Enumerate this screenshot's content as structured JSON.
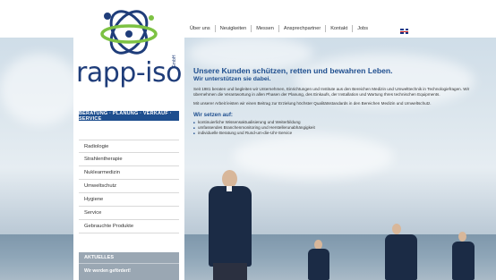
{
  "brand": {
    "logo_text": "rapp-iso",
    "logo_suffix": "GmbH",
    "colors": {
      "primary": "#1f4f8f",
      "accent_green": "#7dc243",
      "dark_navy": "#1f3d7a"
    }
  },
  "topnav": {
    "items": [
      {
        "label": "Über uns"
      },
      {
        "label": "Neuigkeiten"
      },
      {
        "label": "Messen"
      },
      {
        "label": "Ansprechpartner"
      },
      {
        "label": "Kontakt"
      },
      {
        "label": "Jobs"
      }
    ],
    "language_icon": "uk-flag-icon"
  },
  "claim_bar": "BERATUNG · PLANUNG · VERKAUF · SERVICE",
  "sidebar": {
    "items": [
      {
        "label": "Radiologie"
      },
      {
        "label": "Strahlentherapie"
      },
      {
        "label": "Nuklearmedizin"
      },
      {
        "label": "Umweltschutz"
      },
      {
        "label": "Hygiene"
      },
      {
        "label": "Service"
      },
      {
        "label": "Gebrauchte Produkte"
      }
    ]
  },
  "news": {
    "title": "AKTUELLES",
    "teaser": "Wir werden gefördert!"
  },
  "main": {
    "headline": "Unsere Kunden schützen, retten und bewahren Leben.",
    "subheadline": "Wir unterstützen sie dabei.",
    "paragraph1": "Seit 1981 beraten und begleiten wir Unternehmen, Einrichtungen und Institute aus den Bereichen Medizin und Umwelttechnik in Technologiefragen. Wir übernehmen die Verantwortung in allen Phasen der Planung, des Einkaufs, der Installation und Wartung Ihres technischen Equipments.",
    "paragraph2": "Mit unserer Arbeit leisten wir einen Beitrag zur Erzielung höchster Qualitätsstandards in den Bereichen Medizin und Umweltschutz.",
    "focus_title": "Wir setzen auf:",
    "focus_items": [
      "kontinuierliche Wissensaktualisierung und Weiterbildung",
      "umfassendes Branchenmonitoring und Herstellerunabhängigkeit",
      "individuelle Beratung und Rund-um-die-Uhr-Service"
    ]
  }
}
